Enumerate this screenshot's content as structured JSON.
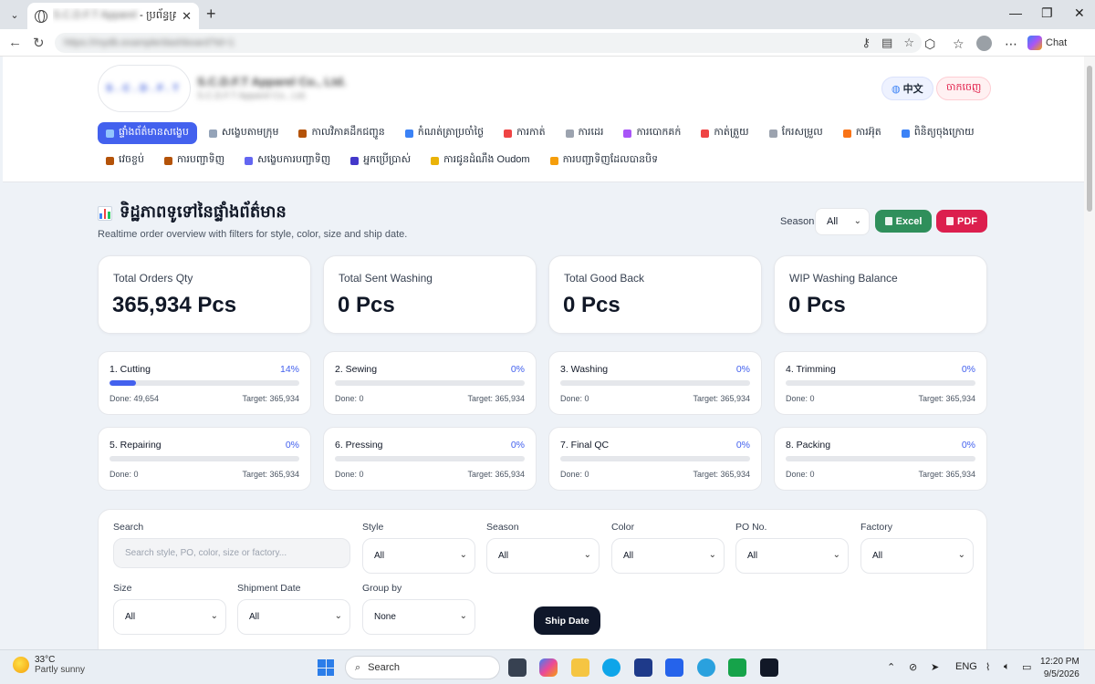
{
  "browser": {
    "tab_title": "ប្រព័ន្ធគ្រប់គ្រងរ",
    "tab_title_blurred": "S.C.D.F.T Apparel",
    "url_blurred": "https://mydb.example/dashboard?id=1",
    "chat_label": "Chat"
  },
  "header": {
    "logo_text": "S.C.D.F.T",
    "company_name": "S.C.D.F.T Apparel Co., Ltd.",
    "company_sub": "S.C.D.F.T Apparel Co., Ltd.",
    "lang_button": "中文",
    "logout_button": "ចាកចេញ"
  },
  "nav": {
    "row1": [
      {
        "label": "ផ្ទាំងព័ត៌មានសង្ខេប",
        "active": true,
        "color": "#93c5fd"
      },
      {
        "label": "សង្ខេបតាមក្រុម",
        "color": "#94a3b8"
      },
      {
        "label": "កាលវិភាគដឹកជញ្ជូន",
        "color": "#b45309"
      },
      {
        "label": "កំណត់ត្រាប្រចាំថ្ងៃ",
        "color": "#3b82f6"
      },
      {
        "label": "ការកាត់",
        "color": "#ef4444"
      },
      {
        "label": "ការដេរ",
        "color": "#9ca3af"
      },
      {
        "label": "ការបោកគក់",
        "color": "#a855f7"
      },
      {
        "label": "កាត់ត្រួយ",
        "color": "#ef4444"
      },
      {
        "label": "កែរសម្រួល",
        "color": "#9ca3af"
      },
      {
        "label": "ការអ៊ុត",
        "color": "#f97316"
      },
      {
        "label": "ពិនិត្យចុងក្រោយ",
        "color": "#3b82f6"
      }
    ],
    "row2": [
      {
        "label": "វេចខ្ចប់",
        "color": "#b45309"
      },
      {
        "label": "ការបញ្ជាទិញ",
        "color": "#b45309"
      },
      {
        "label": "សង្ខេបការបញ្ជាទិញ",
        "color": "#6366f1"
      },
      {
        "label": "អ្នកប្រើប្រាស់",
        "color": "#4338ca"
      },
      {
        "label": "ការជូនដំណឹង Oudom",
        "color": "#eab308"
      },
      {
        "label": "ការបញ្ជាទិញដែលបានបិទ",
        "color": "#f59e0b"
      }
    ]
  },
  "overview": {
    "title": "ទិដ្ឋភាពទូទៅនៃផ្ទាំងព័ត៌មាន",
    "subtitle": "Realtime order overview with filters for style, color, size and ship date.",
    "season_label": "Season",
    "season_value": "All",
    "excel_label": "Excel",
    "pdf_label": "PDF"
  },
  "kpis": [
    {
      "label": "Total Orders Qty",
      "value": "365,934 Pcs"
    },
    {
      "label": "Total Sent Washing",
      "value": "0 Pcs"
    },
    {
      "label": "Total Good Back",
      "value": "0 Pcs"
    },
    {
      "label": "WIP Washing Balance",
      "value": "0 Pcs"
    }
  ],
  "stages": [
    {
      "name": "1. Cutting",
      "pct": "14%",
      "progress": 0.14,
      "done": "Done: 49,654",
      "target": "Target: 365,934"
    },
    {
      "name": "2. Sewing",
      "pct": "0%",
      "progress": 0,
      "done": "Done: 0",
      "target": "Target: 365,934"
    },
    {
      "name": "3. Washing",
      "pct": "0%",
      "progress": 0,
      "done": "Done: 0",
      "target": "Target: 365,934"
    },
    {
      "name": "4. Trimming",
      "pct": "0%",
      "progress": 0,
      "done": "Done: 0",
      "target": "Target: 365,934"
    },
    {
      "name": "5. Repairing",
      "pct": "0%",
      "progress": 0,
      "done": "Done: 0",
      "target": "Target: 365,934"
    },
    {
      "name": "6. Pressing",
      "pct": "0%",
      "progress": 0,
      "done": "Done: 0",
      "target": "Target: 365,934"
    },
    {
      "name": "7. Final QC",
      "pct": "0%",
      "progress": 0,
      "done": "Done: 0",
      "target": "Target: 365,934"
    },
    {
      "name": "8. Packing",
      "pct": "0%",
      "progress": 0,
      "done": "Done: 0",
      "target": "Target: 365,934"
    }
  ],
  "filters": {
    "search_label": "Search",
    "search_placeholder": "Search style, PO, color, size or factory...",
    "style_label": "Style",
    "style_value": "All",
    "season_label": "Season",
    "season_value": "All",
    "color_label": "Color",
    "color_value": "All",
    "po_label": "PO No.",
    "po_value": "All",
    "factory_label": "Factory",
    "factory_value": "All",
    "size_label": "Size",
    "size_value": "All",
    "shipment_label": "Shipment Date",
    "shipment_value": "All",
    "groupby_label": "Group by",
    "groupby_value": "None",
    "shipdate_button": "Ship Date"
  },
  "taskbar": {
    "temp": "33°C",
    "weather": "Partly sunny",
    "search": "Search",
    "lang": "ENG",
    "time": "12:20 PM",
    "date": "9/5/2026"
  }
}
